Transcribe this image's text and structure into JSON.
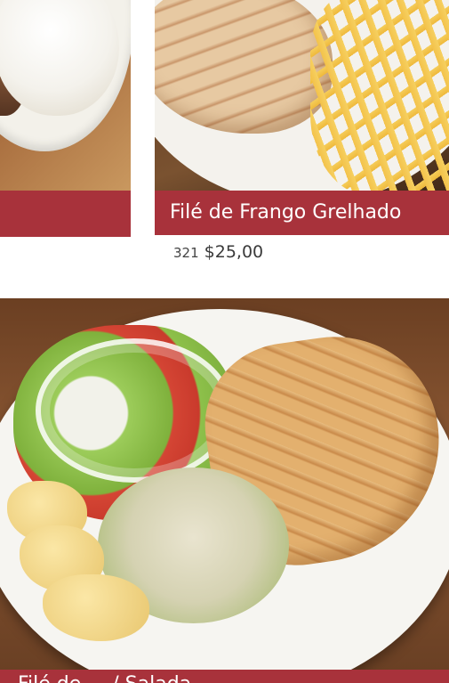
{
  "menu": {
    "items": [
      {
        "image_alt": "",
        "title": "",
        "code": "",
        "price": ""
      },
      {
        "image_alt": "",
        "title": "Filé de Frango Grelhado",
        "code": "321",
        "price": "$25,00"
      },
      {
        "image_alt": "",
        "title": "Filé de ... / Salada",
        "code": "",
        "price": ""
      }
    ]
  },
  "colors": {
    "accent_bar": "#a8323b",
    "title_text": "#ffffff",
    "price_text": "#3a3a3a",
    "background": "#ffffff"
  }
}
